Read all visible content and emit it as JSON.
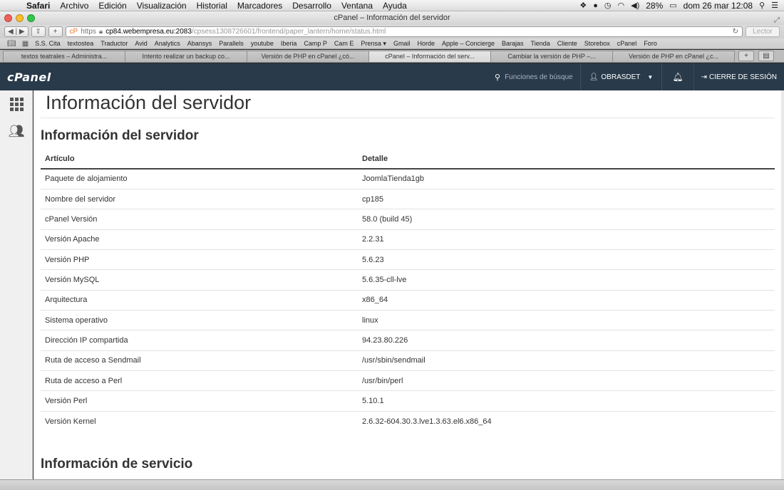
{
  "menubar": {
    "items": [
      "Safari",
      "Archivo",
      "Edición",
      "Visualización",
      "Historial",
      "Marcadores",
      "Desarrollo",
      "Ventana",
      "Ayuda"
    ],
    "battery": "28%",
    "clock": "dom 26 mar  12:08"
  },
  "window": {
    "title": "cPanel – Información del servidor"
  },
  "toolbar": {
    "url_scheme": "https",
    "url_host": "cp84.webempresa.eu:2083",
    "url_path": "/cpsess1308726601/frontend/paper_lantern/home/status.html",
    "reader_label": "Lector"
  },
  "bookmarks": [
    "S.S. Cita",
    "textostea",
    "Traductor",
    "Avid",
    "Analytics",
    "Abansys",
    "Parallels",
    "youtube",
    "Iberia",
    "Camp P",
    "Cam E",
    "Prensa ▾",
    "Gmail",
    "Horde",
    "Apple – Concierge",
    "Barajas",
    "Tienda",
    "Cliente",
    "Storebox",
    "cPanel",
    "Foro"
  ],
  "tabs": [
    {
      "label": "textos teatrales – Administra...",
      "active": false
    },
    {
      "label": "Intento realizar un backup co...",
      "active": false
    },
    {
      "label": "Versión de PHP en cPanel ¿có...",
      "active": false
    },
    {
      "label": "cPanel – Información del serv...",
      "active": true
    },
    {
      "label": "Cambiar la versión de PHP –...",
      "active": false
    },
    {
      "label": "Versión de PHP en cPanel ¿c...",
      "active": false
    }
  ],
  "header": {
    "logo": "cPanel",
    "search_placeholder": "Funciones de búsque",
    "user": "OBRASDET",
    "logout": "CIERRE DE SESIÓN"
  },
  "main": {
    "page_title": "Información del servidor",
    "section1_title": "Información del servidor",
    "section2_title": "Información de servicio",
    "table_headers": [
      "Artículo",
      "Detalle"
    ],
    "rows": [
      [
        "Paquete de alojamiento",
        "JoomlaTienda1gb"
      ],
      [
        "Nombre del servidor",
        "cp185"
      ],
      [
        "cPanel Versión",
        "58.0 (build 45)"
      ],
      [
        "Versión Apache",
        "2.2.31"
      ],
      [
        "Versión PHP",
        "5.6.23"
      ],
      [
        "Versión MySQL",
        "5.6.35-cll-lve"
      ],
      [
        "Arquitectura",
        "x86_64"
      ],
      [
        "Sistema operativo",
        "linux"
      ],
      [
        "Dirección IP compartida",
        "94.23.80.226"
      ],
      [
        "Ruta de acceso a Sendmail",
        "/usr/sbin/sendmail"
      ],
      [
        "Ruta de acceso a Perl",
        "/usr/bin/perl"
      ],
      [
        "Versión Perl",
        "5.10.1"
      ],
      [
        "Versión Kernel",
        "2.6.32-604.30.3.lve1.3.63.el6.x86_64"
      ]
    ]
  }
}
